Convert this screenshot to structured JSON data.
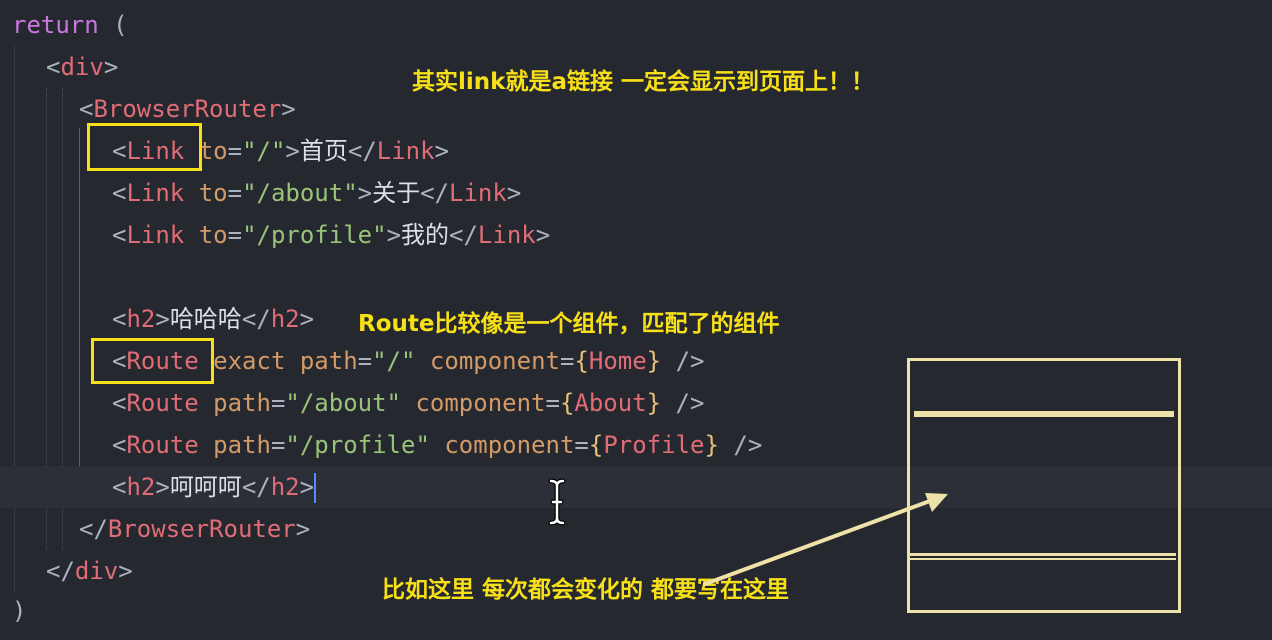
{
  "code": {
    "l1": {
      "kw": "return",
      "paren": " ("
    },
    "l2": {
      "open": "<",
      "tag": "div",
      "close": ">"
    },
    "l3": {
      "open": "<",
      "tag": "BrowserRouter",
      "close": ">"
    },
    "l4": {
      "open": "<",
      "tag": "Link",
      "attr": " to",
      "eq": "=",
      "val": "\"/\"",
      "close": ">",
      "text": "首页",
      "end_open": "</",
      "end_tag": "Link",
      "end_close": ">"
    },
    "l5": {
      "open": "<",
      "tag": "Link",
      "attr": " to",
      "eq": "=",
      "val": "\"/about\"",
      "close": ">",
      "text": "关于",
      "end_open": "</",
      "end_tag": "Link",
      "end_close": ">"
    },
    "l6": {
      "open": "<",
      "tag": "Link",
      "attr": " to",
      "eq": "=",
      "val": "\"/profile\"",
      "close": ">",
      "text": "我的",
      "end_open": "</",
      "end_tag": "Link",
      "end_close": ">"
    },
    "l8": {
      "open": "<",
      "tag": "h2",
      "close": ">",
      "text": "哈哈哈",
      "end_open": "</",
      "end_tag": "h2",
      "end_close": ">"
    },
    "l9": {
      "open": "<",
      "tag": "Route",
      "a1": " exact path",
      "eq1": "=",
      "v1": "\"/\"",
      "a2": " component",
      "eq2": "=",
      "b1": "{",
      "comp": "Home",
      "b2": "}",
      "end": " />"
    },
    "l10": {
      "open": "<",
      "tag": "Route",
      "a1": " path",
      "eq1": "=",
      "v1": "\"/about\"",
      "a2": " component",
      "eq2": "=",
      "b1": "{",
      "comp": "About",
      "b2": "}",
      "end": " />"
    },
    "l11": {
      "open": "<",
      "tag": "Route",
      "a1": " path",
      "eq1": "=",
      "v1": "\"/profile\"",
      "a2": " component",
      "eq2": "=",
      "b1": "{",
      "comp": "Profile",
      "b2": "}",
      "end": " />"
    },
    "l12": {
      "open": "<",
      "tag": "h2",
      "close": ">",
      "text": "呵呵呵",
      "end_open": "</",
      "end_tag": "h2",
      "end_close": ">"
    },
    "l13": {
      "open": "</",
      "tag": "BrowserRouter",
      "close": ">"
    },
    "l14": {
      "open": "</",
      "tag": "div",
      "close": ">"
    },
    "l15": {
      "paren": ")"
    }
  },
  "annotations": {
    "top": "其实link就是a链接 一定会显示到页面上！！",
    "middle": "Route比较像是一个组件，匹配了的组件",
    "bottom": "比如这里 每次都会变化的 都要写在这里"
  },
  "colors": {
    "highlight": "#f7e017",
    "frame": "#efe2a8",
    "caret": "#528bff"
  }
}
